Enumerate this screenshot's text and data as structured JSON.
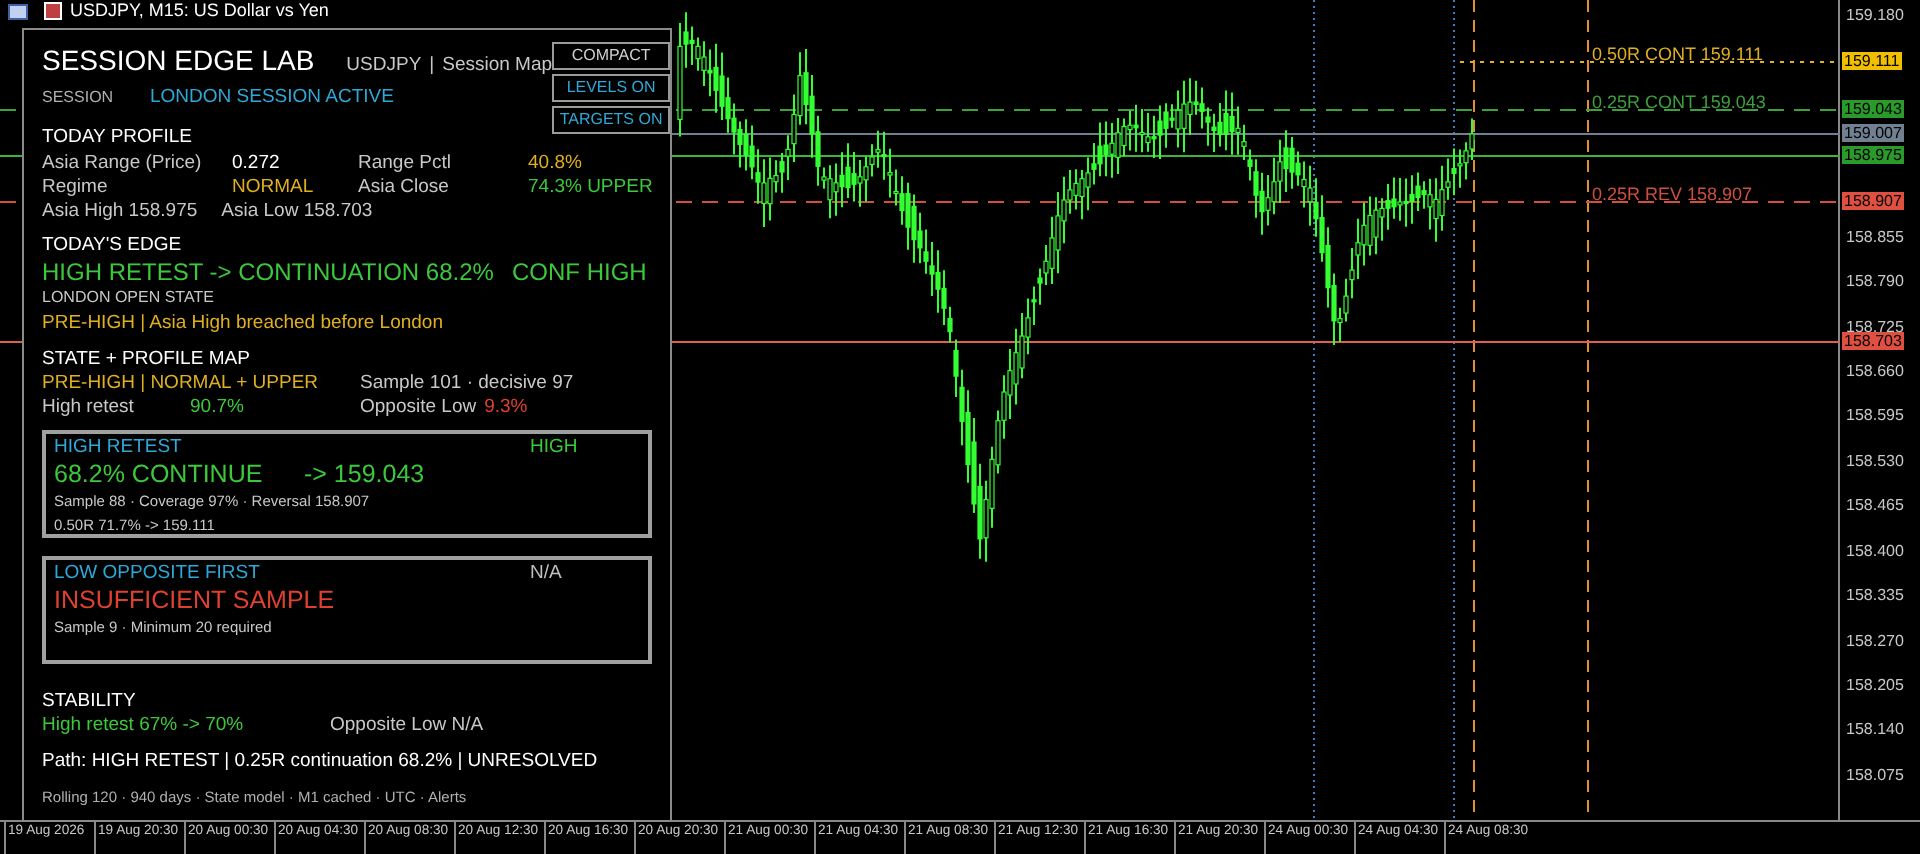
{
  "chart_window": {
    "title": "USDJPY, M15:  US Dollar vs Yen"
  },
  "panel": {
    "title": "SESSION EDGE LAB",
    "symbol": "USDJPY",
    "separator": "|",
    "view": "Session Map",
    "buttons": [
      {
        "label": "COMPACT",
        "color": "#d0d0d0"
      },
      {
        "label": "LEVELS ON",
        "color": "#2fa8d8"
      },
      {
        "label": "TARGETS ON",
        "color": "#2fa8d8"
      }
    ],
    "session": {
      "label": "SESSION",
      "value": "LONDON SESSION ACTIVE"
    },
    "today_profile": {
      "heading": "TODAY PROFILE",
      "stats": [
        {
          "label": "Asia Range (Price)",
          "value": "0.272",
          "color": "#ffffff"
        },
        {
          "label": "Range Pctl",
          "value": "40.8%",
          "color": "#e0b020"
        },
        {
          "label": "Regime",
          "value": "NORMAL",
          "color": "#e0b020"
        },
        {
          "label": "Asia Close",
          "value": "74.3%  UPPER",
          "color": "#3cc83c"
        }
      ],
      "asia_high": "Asia High  158.975",
      "asia_low": "Asia Low  158.703"
    },
    "todays_edge": {
      "heading": "TODAY'S EDGE",
      "signal": "HIGH RETEST -> CONTINUATION 68.2%",
      "confidence": "CONF HIGH",
      "open_state_label": "LONDON OPEN STATE",
      "open_state": "PRE-HIGH | Asia High breached before London"
    },
    "state_map": {
      "heading": "STATE + PROFILE MAP",
      "state": "PRE-HIGH | NORMAL + UPPER",
      "sample": "Sample 101  ·  decisive 97",
      "left": {
        "label": "High retest",
        "value": "90.7%",
        "color": "#3cc83c"
      },
      "right": {
        "label": "Opposite Low",
        "value": "9.3%",
        "color": "#e04030"
      }
    },
    "cards": [
      {
        "title": "HIGH RETEST",
        "badge": {
          "label": "HIGH",
          "color": "#3cc83c"
        },
        "headline": {
          "text": "68.2% CONTINUE",
          "color": "#3cc83c"
        },
        "target": "->  159.043",
        "details": [
          "Sample 88  ·  Coverage 97%  ·  Reversal 158.907",
          "0.50R  71.7% -> 159.111"
        ]
      },
      {
        "title": "LOW OPPOSITE FIRST",
        "badge": {
          "label": "N/A",
          "color": "#c0c0c0"
        },
        "headline": {
          "text": "INSUFFICIENT SAMPLE",
          "color": "#e04030"
        },
        "details": [
          "Sample 9  ·  Minimum 20 required"
        ]
      }
    ],
    "stability": {
      "heading": "STABILITY",
      "left": "High retest  67% -> 70%",
      "right": "Opposite Low  N/A"
    },
    "path": "Path: HIGH RETEST | 0.25R continuation 68.2% | UNRESOLVED",
    "footer": "Rolling 120  ·  940 days  ·  State model  ·  M1 cached  ·  UTC  ·  Alerts"
  },
  "levels": [
    {
      "label": "0.50R CONT  159.111",
      "color": "#e0b020",
      "kind": "dotted"
    },
    {
      "label": "0.25R CONT  159.043",
      "color": "#3ca03c",
      "kind": "dashed"
    },
    {
      "label": "0.25R REV  158.907",
      "color": "#d05040",
      "kind": "dashed"
    }
  ],
  "price_axis": [
    {
      "label": "159.180",
      "kind": "tick"
    },
    {
      "label": "159.111",
      "kind": "tag",
      "color": "#f0c000"
    },
    {
      "label": "159.043",
      "kind": "tag",
      "color": "#2a9a2a"
    },
    {
      "label": "159.007",
      "kind": "tag",
      "color": "#708090"
    },
    {
      "label": "158.975",
      "kind": "tag",
      "color": "#2a9a2a"
    },
    {
      "label": "158.907",
      "kind": "tag",
      "color": "#e05040"
    },
    {
      "label": "158.855",
      "kind": "tick"
    },
    {
      "label": "158.790",
      "kind": "tick"
    },
    {
      "label": "158.725",
      "kind": "tick"
    },
    {
      "label": "158.703",
      "kind": "tag",
      "color": "#e05040"
    },
    {
      "label": "158.660",
      "kind": "tick"
    },
    {
      "label": "158.595",
      "kind": "tick"
    },
    {
      "label": "158.530",
      "kind": "tick"
    },
    {
      "label": "158.465",
      "kind": "tick"
    },
    {
      "label": "158.400",
      "kind": "tick"
    },
    {
      "label": "158.335",
      "kind": "tick"
    },
    {
      "label": "158.270",
      "kind": "tick"
    },
    {
      "label": "158.205",
      "kind": "tick"
    },
    {
      "label": "158.140",
      "kind": "tick"
    },
    {
      "label": "158.075",
      "kind": "tick"
    }
  ],
  "time_axis": [
    "19 Aug 2026",
    "19 Aug 20:30",
    "20 Aug 00:30",
    "20 Aug 04:30",
    "20 Aug 08:30",
    "20 Aug 12:30",
    "20 Aug 16:30",
    "20 Aug 20:30",
    "21 Aug 00:30",
    "21 Aug 04:30",
    "21 Aug 08:30",
    "21 Aug 12:30",
    "21 Aug 16:30",
    "21 Aug 20:30",
    "24 Aug 00:30",
    "24 Aug 04:30",
    "24 Aug 08:30"
  ]
}
